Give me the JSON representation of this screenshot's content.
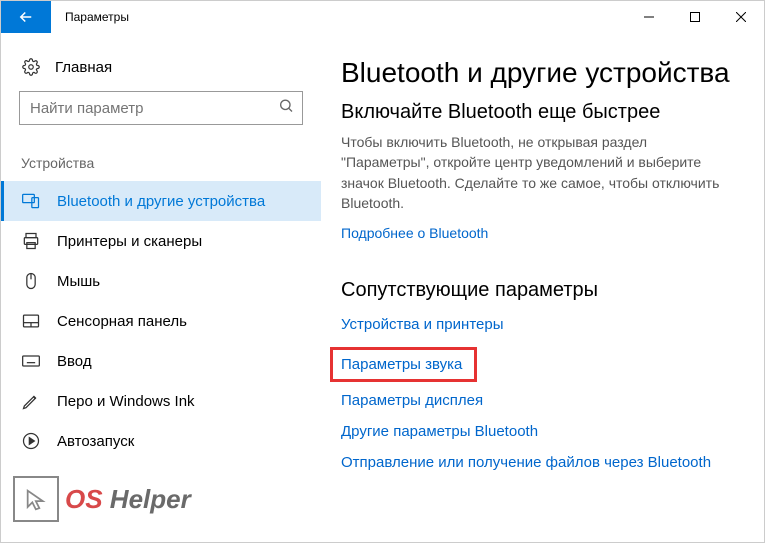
{
  "window": {
    "title": "Параметры"
  },
  "sidebar": {
    "home_label": "Главная",
    "search_placeholder": "Найти параметр",
    "section_label": "Устройства",
    "items": [
      {
        "label": "Bluetooth и другие устройства",
        "active": true
      },
      {
        "label": "Принтеры и сканеры"
      },
      {
        "label": "Мышь"
      },
      {
        "label": "Сенсорная панель"
      },
      {
        "label": "Ввод"
      },
      {
        "label": "Перо и Windows Ink"
      },
      {
        "label": "Автозапуск"
      }
    ]
  },
  "main": {
    "heading": "Bluetooth и другие устройства",
    "subheading": "Включайте Bluetooth еще быстрее",
    "description": "Чтобы включить Bluetooth, не открывая раздел \"Параметры\", откройте центр уведомлений и выберите значок Bluetooth. Сделайте то же самое, чтобы отключить Bluetooth.",
    "learn_more": "Подробнее о Bluetooth",
    "related_heading": "Сопутствующие параметры",
    "related_links": [
      "Устройства и принтеры",
      "Параметры звука",
      "Параметры дисплея",
      "Другие параметры Bluetooth",
      "Отправление или получение файлов через Bluetooth"
    ],
    "highlighted_index": 1
  },
  "watermark": {
    "text_a": "OS",
    "text_b": " Helper"
  }
}
